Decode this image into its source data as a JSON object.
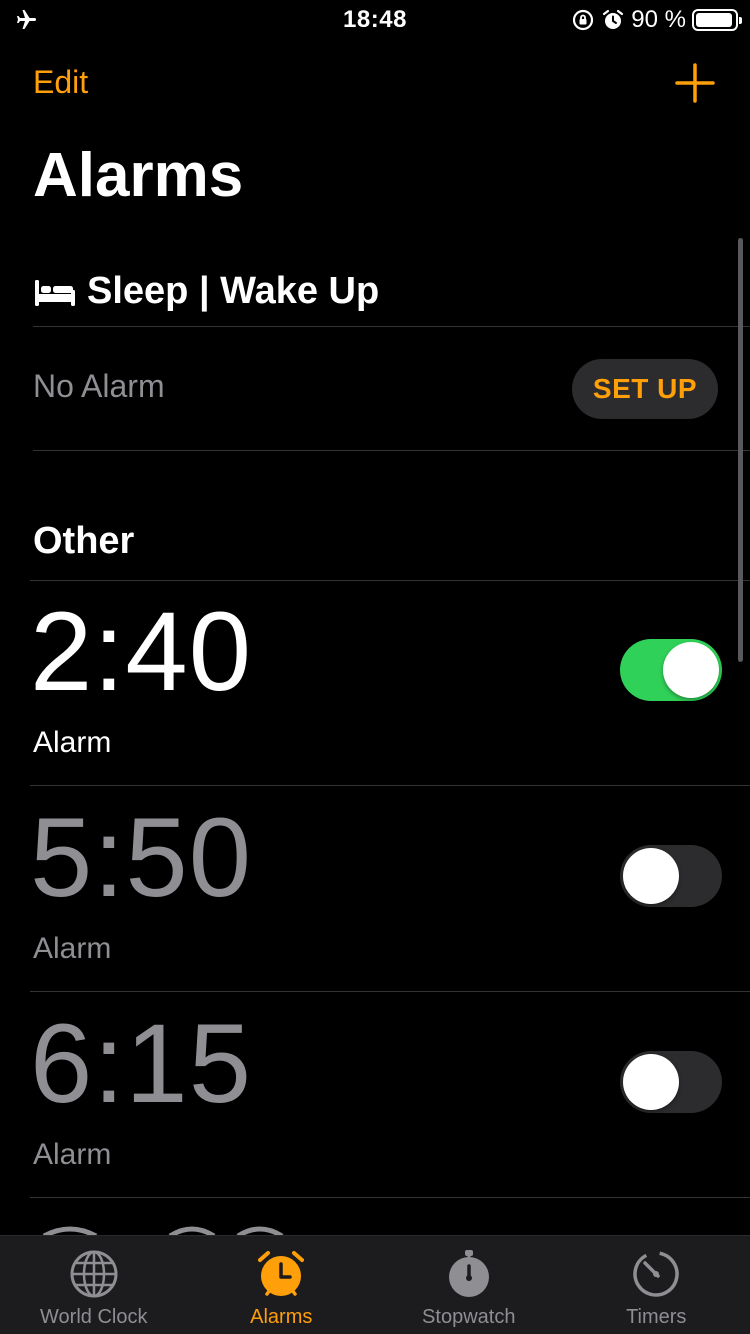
{
  "status_bar": {
    "time": "18:48",
    "battery": "90 %",
    "airplane_icon": "airplane-icon",
    "orientation_lock_icon": "orientation-lock-icon",
    "alarm_icon": "alarm-icon",
    "battery_level": 0.9
  },
  "nav": {
    "edit_label": "Edit",
    "add_icon": "plus-icon"
  },
  "title": "Alarms",
  "sleep": {
    "header": "Sleep | Wake Up",
    "icon": "bed-icon",
    "status": "No Alarm",
    "setup_label": "SET UP"
  },
  "other_header": "Other",
  "alarms": [
    {
      "time": "2:40",
      "label": "Alarm",
      "enabled": true
    },
    {
      "time": "5:50",
      "label": "Alarm",
      "enabled": false
    },
    {
      "time": "6:15",
      "label": "Alarm",
      "enabled": false
    }
  ],
  "tabs": [
    {
      "label": "World Clock",
      "icon": "globe-icon",
      "active": false
    },
    {
      "label": "Alarms",
      "icon": "alarm-clock-icon",
      "active": true
    },
    {
      "label": "Stopwatch",
      "icon": "stopwatch-icon",
      "active": false
    },
    {
      "label": "Timers",
      "icon": "timer-icon",
      "active": false
    }
  ],
  "colors": {
    "accent": "#ff9f0a",
    "toggle_on": "#30d158",
    "secondary_text": "#8e8e93",
    "background": "#000000"
  }
}
